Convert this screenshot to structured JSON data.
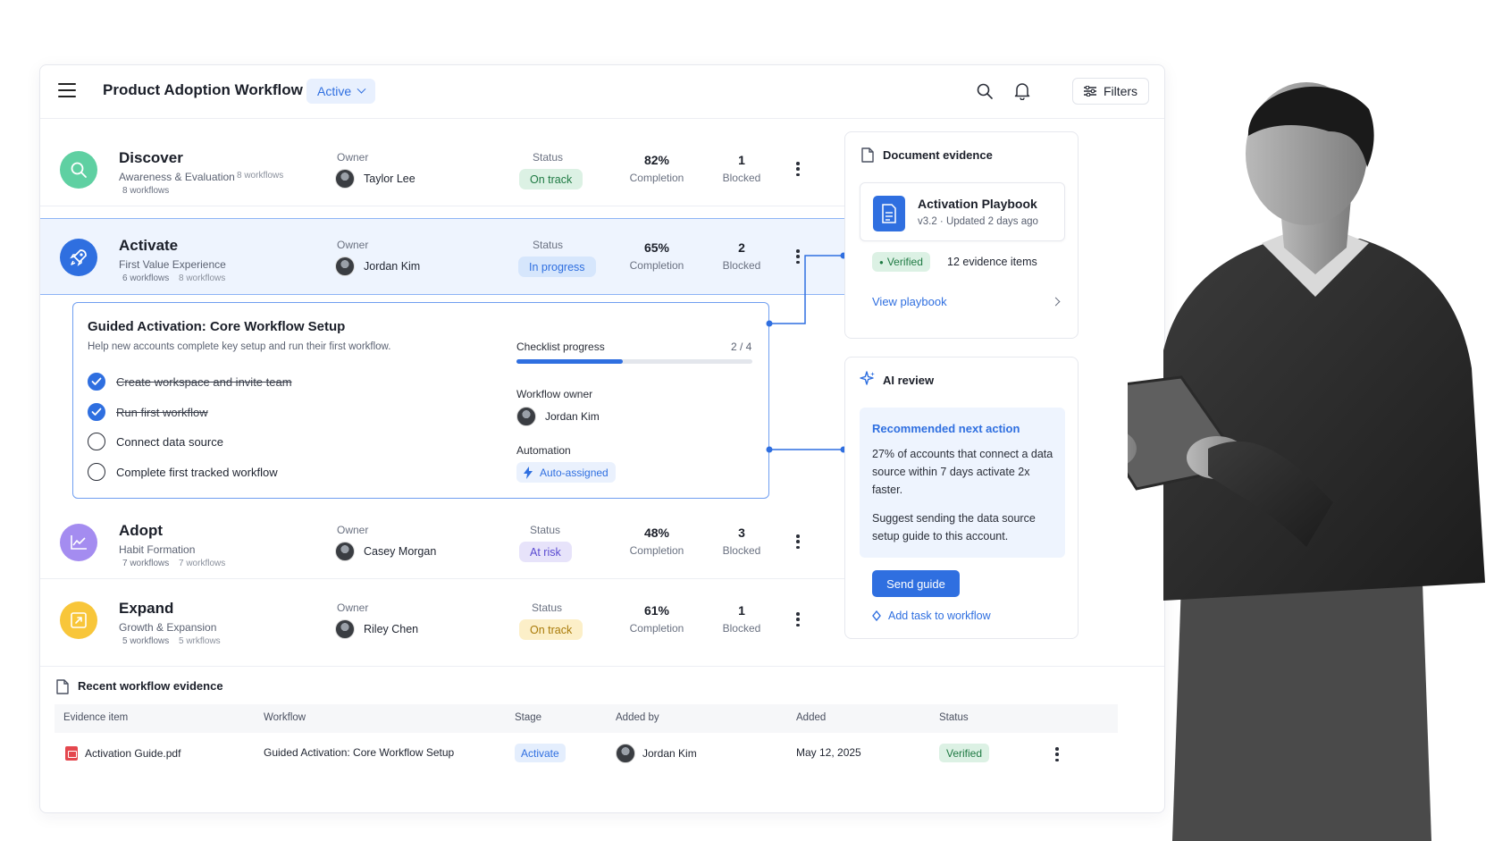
{
  "header": {
    "title": "Product Adoption Workflow",
    "status_label": "Active",
    "filters_label": "Filters"
  },
  "labels": {
    "owner": "Owner",
    "status": "Status",
    "completion": "Completion",
    "blocked": "Blocked"
  },
  "stages": [
    {
      "name": "Discover",
      "subtitle": "Awareness & Evaluation",
      "workflows": "8 workflows",
      "workflows_ghost": "8 workflows",
      "owner": "Taylor Lee",
      "status": "On track",
      "status_color": "green",
      "completion": "82%",
      "blocked": "1",
      "icon": "search-icon",
      "icon_bg": "#5fd0a2"
    },
    {
      "name": "Activate",
      "subtitle": "First Value Experience",
      "workflows": "6 workflows",
      "workflows_ghost": "8 workflows",
      "owner": "Jordan Kim",
      "status": "In progress",
      "status_color": "blue",
      "completion": "65%",
      "blocked": "2",
      "icon": "rocket-icon",
      "icon_bg": "#2f6fe0"
    },
    {
      "name": "Adopt",
      "subtitle": "Habit Formation",
      "workflows": "7 workflows",
      "workflows_ghost": "7 workflows",
      "owner": "Casey Morgan",
      "status": "At risk",
      "status_color": "purple",
      "completion": "48%",
      "blocked": "3",
      "icon": "chart-icon",
      "icon_bg": "#a48cf0"
    },
    {
      "name": "Expand",
      "subtitle": "Growth & Expansion",
      "workflows": "5 workflows",
      "workflows_ghost": "5 wrkflows",
      "owner": "Riley Chen",
      "status": "On track",
      "status_color": "yellow",
      "completion": "61%",
      "blocked": "1",
      "icon": "expand-icon",
      "icon_bg": "#f8c63a"
    }
  ],
  "guide": {
    "title": "Guided Activation: Core Workflow Setup",
    "description": "Help new accounts complete key setup and run their first workflow.",
    "tasks": [
      {
        "label": "Create workspace and invite team",
        "done": true
      },
      {
        "label": "Run first workflow",
        "done": true
      },
      {
        "label": "Connect data source",
        "done": false
      },
      {
        "label": "Complete first tracked workflow",
        "done": false
      }
    ],
    "checklist_label": "Checklist progress",
    "checklist_count": "2 / 4",
    "checklist_progress": 0.45,
    "owner_label": "Workflow owner",
    "owner": "Jordan Kim",
    "automation_label": "Automation",
    "automation_value": "Auto-assigned"
  },
  "document_evidence": {
    "title": "Document evidence",
    "doc_name": "Activation Playbook",
    "doc_meta": "v3.2 · Updated 2 days ago",
    "verified": "Verified",
    "evidence_count": "12 evidence items",
    "view_link": "View playbook"
  },
  "ai_review": {
    "title": "AI review",
    "rec_title": "Recommended next action",
    "rec_p1": "27% of accounts that connect a data source within 7 days activate 2x faster.",
    "rec_p2": "Suggest sending the data source setup guide to this account.",
    "send_button": "Send guide",
    "add_task": "Add task to workflow"
  },
  "recent": {
    "title": "Recent workflow evidence",
    "columns": [
      "Evidence item",
      "Workflow",
      "Stage",
      "Added by",
      "Added",
      "Status"
    ],
    "rows": [
      {
        "item": "Activation Guide.pdf",
        "workflow": "Guided Activation: Core Workflow Setup",
        "stage": "Activate",
        "added_by": "Jordan Kim",
        "added": "May 12, 2025",
        "status": "Verified"
      }
    ]
  },
  "colors": {
    "accent": "#2f6fe0",
    "success": "#1f7a43",
    "warning": "#a97a08",
    "risk": "#5a4ad1"
  }
}
